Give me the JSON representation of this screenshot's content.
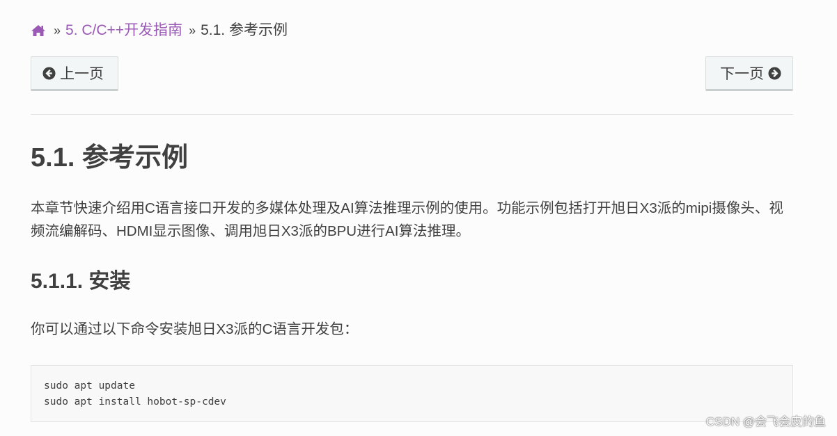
{
  "breadcrumb": {
    "separator": "»",
    "section_link": "5. C/C++开发指南",
    "current": "5.1. 参考示例"
  },
  "nav": {
    "prev_label": "上一页",
    "next_label": "下一页"
  },
  "content": {
    "title": "5.1. 参考示例",
    "intro": "本章节快速介绍用C语言接口开发的多媒体处理及AI算法推理示例的使用。功能示例包括打开旭日X3派的mipi摄像头、视频流编解码、HDMI显示图像、调用旭日X3派的BPU进行AI算法推理。",
    "install_heading": "5.1.1. 安装",
    "install_text": "你可以通过以下命令安装旭日X3派的C语言开发包：",
    "code_lines": [
      "sudo apt update",
      "sudo apt install hobot-sp-cdev"
    ]
  },
  "watermark": "CSDN @会飞会皮的鱼",
  "colors": {
    "link": "#9b59b6",
    "text": "#404040",
    "button_bg": "#f3f6f6",
    "code_bg": "#f8f8f8"
  }
}
